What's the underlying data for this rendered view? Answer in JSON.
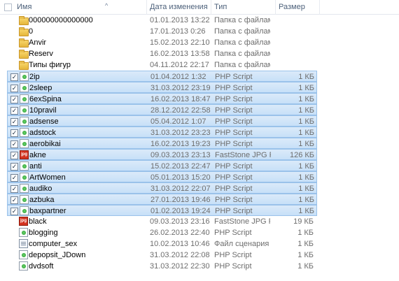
{
  "columns": {
    "name": "Имя",
    "date": "Дата изменения",
    "type": "Тип",
    "size": "Размер"
  },
  "files": [
    {
      "name": "000000000000000",
      "date": "01.01.2013 13:22",
      "type": "Папка с файлами",
      "size": "",
      "icon": "folder",
      "selected": false
    },
    {
      "name": "0",
      "date": "17.01.2013 0:26",
      "type": "Папка с файлами",
      "size": "",
      "icon": "folder",
      "selected": false
    },
    {
      "name": "Anvir",
      "date": "15.02.2013 22:10",
      "type": "Папка с файлами",
      "size": "",
      "icon": "folder",
      "selected": false
    },
    {
      "name": "Reserv",
      "date": "16.02.2013 13:58",
      "type": "Папка с файлами",
      "size": "",
      "icon": "folder",
      "selected": false
    },
    {
      "name": "Типы фигур",
      "date": "04.11.2012 22:17",
      "type": "Папка с файлами",
      "size": "",
      "icon": "folder",
      "selected": false
    },
    {
      "name": "2ip",
      "date": "01.04.2012 1:32",
      "type": "PHP Script",
      "size": "1 КБ",
      "icon": "php",
      "selected": true
    },
    {
      "name": "2sleep",
      "date": "31.03.2012 23:19",
      "type": "PHP Script",
      "size": "1 КБ",
      "icon": "php",
      "selected": true
    },
    {
      "name": "6exSpina",
      "date": "16.02.2013 18:47",
      "type": "PHP Script",
      "size": "1 КБ",
      "icon": "php",
      "selected": true
    },
    {
      "name": "10pravil",
      "date": "28.12.2012 22:58",
      "type": "PHP Script",
      "size": "1 КБ",
      "icon": "php",
      "selected": true
    },
    {
      "name": "adsense",
      "date": "05.04.2012 1:07",
      "type": "PHP Script",
      "size": "1 КБ",
      "icon": "php",
      "selected": true
    },
    {
      "name": "adstock",
      "date": "31.03.2012 23:23",
      "type": "PHP Script",
      "size": "1 КБ",
      "icon": "php",
      "selected": true
    },
    {
      "name": "aerobikai",
      "date": "16.02.2013 19:23",
      "type": "PHP Script",
      "size": "1 КБ",
      "icon": "php",
      "selected": true
    },
    {
      "name": "akne",
      "date": "09.03.2013 23:13",
      "type": "FastStone JPG File",
      "size": "126 КБ",
      "icon": "jpg",
      "selected": true
    },
    {
      "name": "anti",
      "date": "15.02.2013 22:47",
      "type": "PHP Script",
      "size": "1 КБ",
      "icon": "php",
      "selected": true
    },
    {
      "name": "ArtWomen",
      "date": "05.01.2013 15:20",
      "type": "PHP Script",
      "size": "1 КБ",
      "icon": "php",
      "selected": true
    },
    {
      "name": "audiko",
      "date": "31.03.2012 22:07",
      "type": "PHP Script",
      "size": "1 КБ",
      "icon": "php",
      "selected": true
    },
    {
      "name": "azbuka",
      "date": "27.01.2013 19:46",
      "type": "PHP Script",
      "size": "1 КБ",
      "icon": "php",
      "selected": true
    },
    {
      "name": "baxpartner",
      "date": "01.02.2013 19:24",
      "type": "PHP Script",
      "size": "1 КБ",
      "icon": "php",
      "selected": true
    },
    {
      "name": "black",
      "date": "09.03.2013 23:16",
      "type": "FastStone JPG File",
      "size": "19 КБ",
      "icon": "jpg",
      "selected": false
    },
    {
      "name": "blogging",
      "date": "26.02.2013 22:40",
      "type": "PHP Script",
      "size": "1 КБ",
      "icon": "php",
      "selected": false
    },
    {
      "name": "computer_sex",
      "date": "10.02.2013 10:46",
      "type": "Файл сценария V...",
      "size": "1 КБ",
      "icon": "script",
      "selected": false
    },
    {
      "name": "depopsit_JDown",
      "date": "31.03.2012 22:08",
      "type": "PHP Script",
      "size": "1 КБ",
      "icon": "php",
      "selected": false
    },
    {
      "name": "dvdsoft",
      "date": "31.03.2012 22:30",
      "type": "PHP Script",
      "size": "1 КБ",
      "icon": "php",
      "selected": false
    }
  ],
  "icons": {
    "folder": "folder-icon",
    "php": "php-script-icon",
    "jpg": "jpg-image-icon",
    "script": "script-file-icon",
    "check": "✓",
    "jpg_text": "jpg"
  },
  "colors": {
    "selection_bg": "#cfe4f9",
    "selection_border": "#9ac2ea",
    "header_text": "#4c607a",
    "meta_text": "#6d6d6d"
  }
}
